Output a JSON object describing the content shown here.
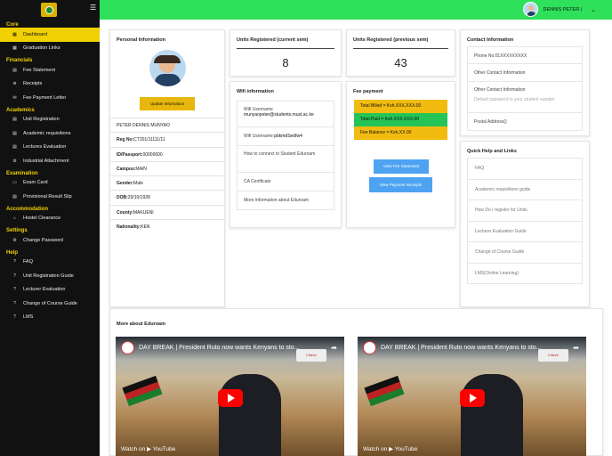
{
  "header": {
    "user_name": "DENNIS PETER |",
    "chevron": "⌄"
  },
  "sidebar": {
    "sections": [
      {
        "title": "Core",
        "items": [
          {
            "label": "Dashboard",
            "icon": "grid-icon",
            "active": true
          },
          {
            "label": "Graduation Links",
            "icon": "grid-icon"
          }
        ]
      },
      {
        "title": "Financials",
        "items": [
          {
            "label": "Fee Statement",
            "icon": "document-icon"
          },
          {
            "label": "Receipts",
            "icon": "receipt-icon"
          },
          {
            "label": "Fee Payment Letter",
            "icon": "envelope-icon"
          }
        ]
      },
      {
        "title": "Academics",
        "items": [
          {
            "label": "Unit Registration",
            "icon": "document-icon"
          },
          {
            "label": "Academic requisitions",
            "icon": "document-icon"
          },
          {
            "label": "Lectures Evaluation",
            "icon": "document-icon"
          },
          {
            "label": "Industrial Attachment",
            "icon": "gear-icon"
          }
        ]
      },
      {
        "title": "Examination",
        "items": [
          {
            "label": "Exam Card",
            "icon": "card-icon"
          },
          {
            "label": "Provisional Result Slip",
            "icon": "document-icon"
          }
        ]
      },
      {
        "title": "Accommodation",
        "items": [
          {
            "label": "Hostel Clearance",
            "icon": "home-icon"
          }
        ]
      },
      {
        "title": "Settings",
        "items": [
          {
            "label": "Change Password",
            "icon": "gear-icon"
          }
        ]
      },
      {
        "title": "Help",
        "items": [
          {
            "label": "FAQ",
            "icon": "question-icon"
          },
          {
            "label": "Unit Registration Guide",
            "icon": "question-icon"
          },
          {
            "label": "Lecturer Evaluation",
            "icon": "question-icon"
          },
          {
            "label": "Change of Course Guide",
            "icon": "question-icon"
          },
          {
            "label": "LMS",
            "icon": "question-icon"
          }
        ]
      }
    ]
  },
  "personal": {
    "title": "Personal Information",
    "update_button": "Update Information",
    "rows": [
      {
        "label": "",
        "value": "PETER DENNIS MUNYAO"
      },
      {
        "label": "Reg No:",
        "value": "CT201/11111/11"
      },
      {
        "label": "ID/Passport:",
        "value": "00000000"
      },
      {
        "label": "Campus:",
        "value": "MAIN"
      },
      {
        "label": "Gender:",
        "value": "Male"
      },
      {
        "label": "DOB:",
        "value": "29/10/1928"
      },
      {
        "label": "County:",
        "value": "MAKUENI"
      },
      {
        "label": "Nationality:",
        "value": "KEN"
      }
    ]
  },
  "units_current": {
    "title": "Units Registered (current sem)",
    "value": "8"
  },
  "units_previous": {
    "title": "Units Registered (previous sem)",
    "value": "43"
  },
  "wifi": {
    "title": "Wifi information",
    "items": [
      {
        "label": "Wifi Username",
        "value": "munyaopeter@students.must.ac.ke"
      },
      {
        "label": "Wifi Username:",
        "value": "pbkmdSedfw4"
      },
      {
        "label": "How to connect to Student Eduroam",
        "value": ""
      },
      {
        "label": "CA Certificate",
        "value": ""
      },
      {
        "label": "More information about Eduroam",
        "value": ""
      }
    ]
  },
  "fee": {
    "title": "Fee payment",
    "billed": "Total Billed = Ksh.XXX,XXX.00",
    "paid": "Total Paid = Ksh.XXX,XXX.00",
    "balance": "Fee Balance = Ksh.XX.00",
    "statement_button": "View Fee Statement",
    "receipts_button": "View Payment Receipts",
    "colors": {
      "billed": "#f2bb0f",
      "paid": "#24c457",
      "balance": "#f2bb0f"
    }
  },
  "contact": {
    "title": "Contact Information",
    "phone": "Phone No:01XXXXXXXXX",
    "other": "Other Contact Information",
    "other2": "Other Contact Information",
    "default_pw": "Default password is your student number",
    "postal": "Postal Address()"
  },
  "quick": {
    "title": "Quick Help and Links",
    "links": [
      "FAQ",
      "Academic requisitions guide",
      "How Do I register for Units",
      "Lecturer Evaluation Guide",
      "Change of Course Guide",
      "LMS(Online Learning)"
    ]
  },
  "more": {
    "title": "More about Eduroam",
    "videos": [
      {
        "title": "DAY BREAK | President Ruto now wants Kenyans to sto...",
        "watch": "Watch on ▶ YouTube",
        "tag": "Citizen"
      },
      {
        "title": "DAY BREAK | President Ruto now wants Kenyans to sto...",
        "watch": "Watch on ▶ YouTube",
        "tag": "Citizen"
      }
    ]
  },
  "colors": {
    "accent_green": "#2ee05a",
    "sidebar": "#111111",
    "section_yellow": "#f0d000",
    "button_blue": "#4da3f2",
    "button_gold": "#e8b70c"
  }
}
